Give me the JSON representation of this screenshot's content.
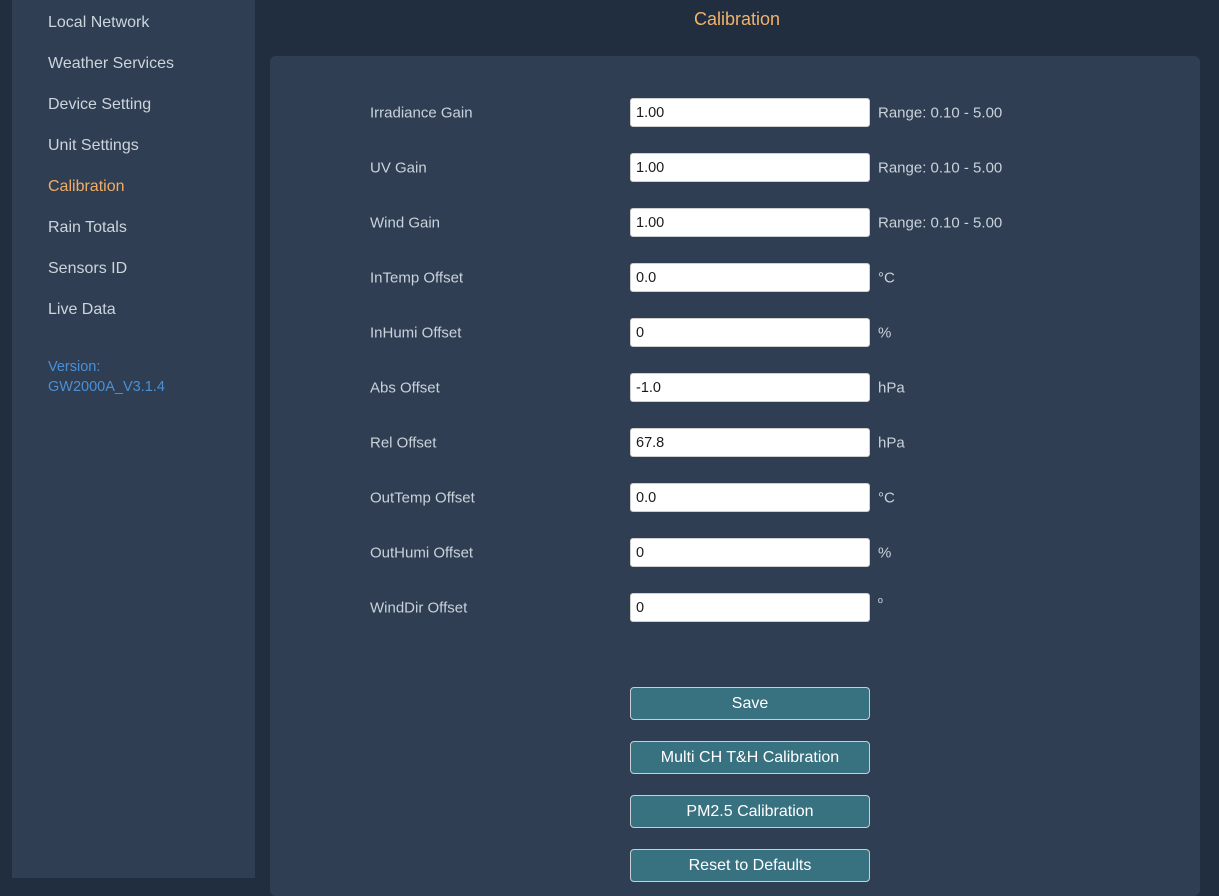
{
  "colors": {
    "page_background": "#212e3f",
    "panel_background": "#2f3e52",
    "accent_orange": "#efae67",
    "version_blue": "#4b90d6",
    "button_teal": "#387180",
    "sidebar_text": "#ccd4dc"
  },
  "sidebar": {
    "items": [
      {
        "label": "Local Network",
        "active": false
      },
      {
        "label": "Weather Services",
        "active": false
      },
      {
        "label": "Device Setting",
        "active": false
      },
      {
        "label": "Unit Settings",
        "active": false
      },
      {
        "label": "Calibration",
        "active": true
      },
      {
        "label": "Rain Totals",
        "active": false
      },
      {
        "label": "Sensors ID",
        "active": false
      },
      {
        "label": "Live Data",
        "active": false
      }
    ],
    "version_label": "Version:",
    "version_value": "GW2000A_V3.1.4"
  },
  "header": {
    "title": "Calibration"
  },
  "calibration_form": {
    "rows": [
      {
        "name": "irradiance-gain",
        "label": "Irradiance Gain",
        "value": "1.00",
        "suffix": "Range: 0.10 - 5.00",
        "suffix_superscript": false
      },
      {
        "name": "uv-gain",
        "label": "UV Gain",
        "value": "1.00",
        "suffix": "Range: 0.10 - 5.00",
        "suffix_superscript": false
      },
      {
        "name": "wind-gain",
        "label": "Wind Gain",
        "value": "1.00",
        "suffix": "Range: 0.10 - 5.00",
        "suffix_superscript": false
      },
      {
        "name": "intemp-offset",
        "label": "InTemp Offset",
        "value": "0.0",
        "suffix": "°C",
        "suffix_superscript": false
      },
      {
        "name": "inhumi-offset",
        "label": "InHumi Offset",
        "value": "0",
        "suffix": "%",
        "suffix_superscript": false
      },
      {
        "name": "abs-offset",
        "label": "Abs Offset",
        "value": "-1.0",
        "suffix": "hPa",
        "suffix_superscript": false
      },
      {
        "name": "rel-offset",
        "label": "Rel Offset",
        "value": "67.8",
        "suffix": "hPa",
        "suffix_superscript": false
      },
      {
        "name": "outtemp-offset",
        "label": "OutTemp Offset",
        "value": "0.0",
        "suffix": "°C",
        "suffix_superscript": false
      },
      {
        "name": "outhumi-offset",
        "label": "OutHumi Offset",
        "value": "0",
        "suffix": "%",
        "suffix_superscript": false
      },
      {
        "name": "winddir-offset",
        "label": "WindDir Offset",
        "value": "0",
        "suffix": "º",
        "suffix_superscript": true
      }
    ],
    "buttons": [
      {
        "name": "save-button",
        "label": "Save"
      },
      {
        "name": "multi-ch-th-calibration-button",
        "label": "Multi CH T&H Calibration"
      },
      {
        "name": "pm25-calibration-button",
        "label": "PM2.5 Calibration"
      },
      {
        "name": "reset-to-defaults-button",
        "label": "Reset to Defaults"
      }
    ]
  }
}
